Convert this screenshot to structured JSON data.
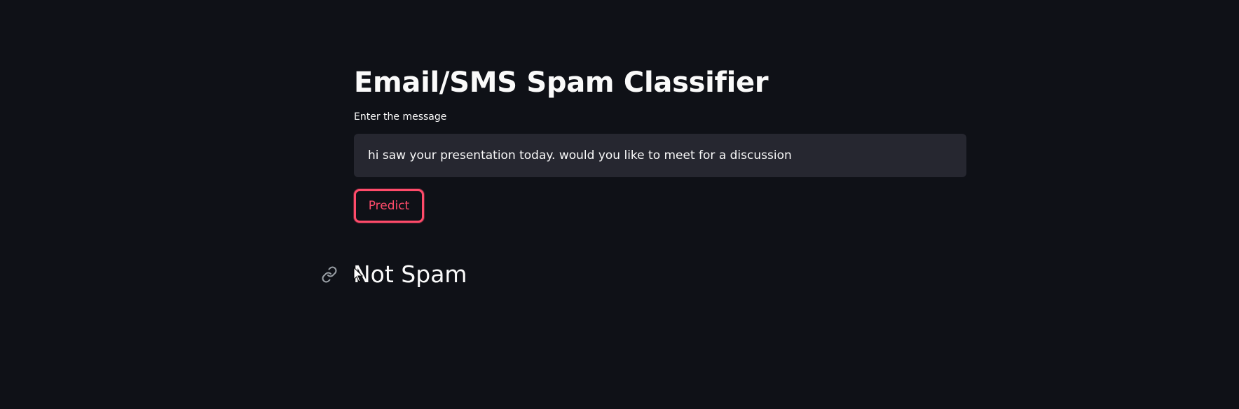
{
  "page": {
    "title": "Email/SMS Spam Classifier"
  },
  "form": {
    "input_label": "Enter the message",
    "input_value": "hi saw your presentation today. would you like to meet for a discussion",
    "predict_label": "Predict"
  },
  "result": {
    "text": "Not Spam"
  },
  "colors": {
    "background": "#0f1117",
    "input_background": "#262730",
    "accent": "#ff4b6a",
    "text": "#fafafa"
  },
  "icons": {
    "anchor": "link-icon",
    "pointer": "mouse-cursor-icon"
  }
}
